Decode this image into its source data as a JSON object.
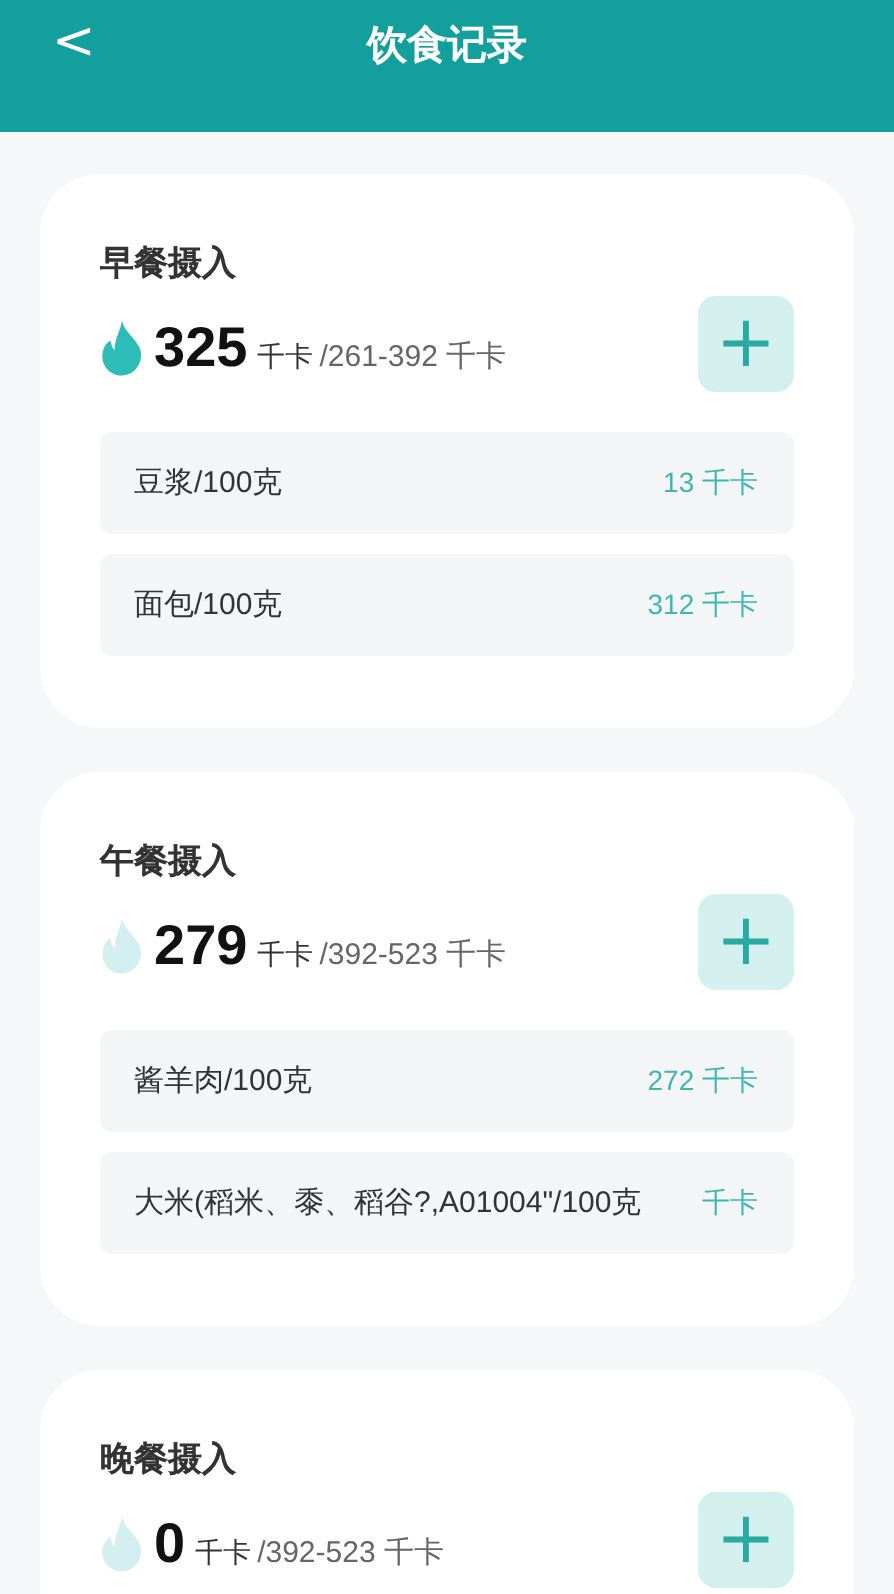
{
  "header": {
    "back": "<",
    "title": "饮食记录"
  },
  "meals": [
    {
      "title": "早餐摄入",
      "in_range": true,
      "kcal": "325",
      "unit": "千卡",
      "range": "/261-392 千卡",
      "add": "+",
      "items": [
        {
          "name": "豆浆/100克",
          "kcal": "13 千卡"
        },
        {
          "name": "面包/100克",
          "kcal": "312 千卡"
        }
      ]
    },
    {
      "title": "午餐摄入",
      "in_range": false,
      "kcal": "279",
      "unit": "千卡",
      "range": "/392-523 千卡",
      "add": "+",
      "items": [
        {
          "name": "酱羊肉/100克",
          "kcal": "272 千卡"
        },
        {
          "name": "大米(稻米、黍、稻谷?,A01004\"/100克",
          "kcal": "千卡"
        }
      ]
    },
    {
      "title": "晚餐摄入",
      "in_range": false,
      "kcal": "0",
      "unit": "千卡",
      "range": "/392-523 千卡",
      "add": "+"
    }
  ]
}
